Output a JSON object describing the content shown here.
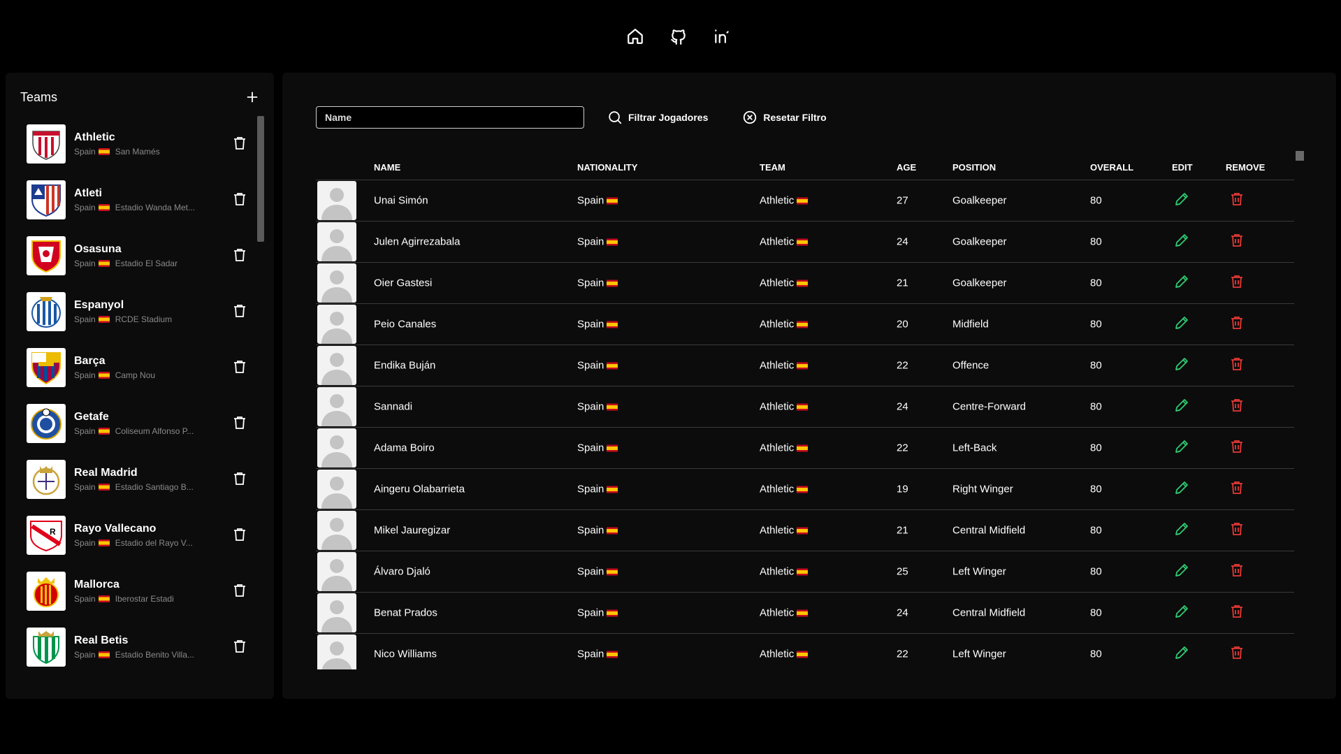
{
  "nav": {
    "icons": [
      "home-icon",
      "github-icon",
      "linkedin-icon"
    ]
  },
  "teams": {
    "title": "Teams",
    "items": [
      {
        "name": "Athletic",
        "country": "Spain",
        "stadium": "San Mamés"
      },
      {
        "name": "Atleti",
        "country": "Spain",
        "stadium": "Estadio Wanda Met..."
      },
      {
        "name": "Osasuna",
        "country": "Spain",
        "stadium": "Estadio El Sadar"
      },
      {
        "name": "Espanyol",
        "country": "Spain",
        "stadium": "RCDE Stadium"
      },
      {
        "name": "Barça",
        "country": "Spain",
        "stadium": "Camp Nou"
      },
      {
        "name": "Getafe",
        "country": "Spain",
        "stadium": "Coliseum Alfonso P..."
      },
      {
        "name": "Real Madrid",
        "country": "Spain",
        "stadium": "Estadio Santiago B..."
      },
      {
        "name": "Rayo Vallecano",
        "country": "Spain",
        "stadium": "Estadio del Rayo V..."
      },
      {
        "name": "Mallorca",
        "country": "Spain",
        "stadium": "Iberostar Estadi"
      },
      {
        "name": "Real Betis",
        "country": "Spain",
        "stadium": "Estadio Benito Villa..."
      }
    ]
  },
  "filter": {
    "name_placeholder": "Name",
    "name_value": "",
    "filter_label": "Filtrar Jogadores",
    "reset_label": "Resetar Filtro"
  },
  "table": {
    "headers": {
      "name": "NAME",
      "nationality": "NATIONALITY",
      "team": "TEAM",
      "age": "AGE",
      "position": "POSITION",
      "overall": "OVERALL",
      "edit": "EDIT",
      "remove": "REMOVE"
    },
    "rows": [
      {
        "name": "Unai Simón",
        "nationality": "Spain",
        "team": "Athletic",
        "age": "27",
        "position": "Goalkeeper",
        "overall": "80"
      },
      {
        "name": "Julen Agirrezabala",
        "nationality": "Spain",
        "team": "Athletic",
        "age": "24",
        "position": "Goalkeeper",
        "overall": "80"
      },
      {
        "name": "Oier Gastesi",
        "nationality": "Spain",
        "team": "Athletic",
        "age": "21",
        "position": "Goalkeeper",
        "overall": "80"
      },
      {
        "name": "Peio Canales",
        "nationality": "Spain",
        "team": "Athletic",
        "age": "20",
        "position": "Midfield",
        "overall": "80"
      },
      {
        "name": "Endika Buján",
        "nationality": "Spain",
        "team": "Athletic",
        "age": "22",
        "position": "Offence",
        "overall": "80"
      },
      {
        "name": "Sannadi",
        "nationality": "Spain",
        "team": "Athletic",
        "age": "24",
        "position": "Centre-Forward",
        "overall": "80"
      },
      {
        "name": "Adama Boiro",
        "nationality": "Spain",
        "team": "Athletic",
        "age": "22",
        "position": "Left-Back",
        "overall": "80"
      },
      {
        "name": "Aingeru Olabarrieta",
        "nationality": "Spain",
        "team": "Athletic",
        "age": "19",
        "position": "Right Winger",
        "overall": "80"
      },
      {
        "name": "Mikel Jauregizar",
        "nationality": "Spain",
        "team": "Athletic",
        "age": "21",
        "position": "Central Midfield",
        "overall": "80"
      },
      {
        "name": "Álvaro Djaló",
        "nationality": "Spain",
        "team": "Athletic",
        "age": "25",
        "position": "Left Winger",
        "overall": "80"
      },
      {
        "name": "Benat Prados",
        "nationality": "Spain",
        "team": "Athletic",
        "age": "24",
        "position": "Central Midfield",
        "overall": "80"
      },
      {
        "name": "Nico Williams",
        "nationality": "Spain",
        "team": "Athletic",
        "age": "22",
        "position": "Left Winger",
        "overall": "80"
      }
    ]
  },
  "colors": {
    "background": "#000000",
    "panel": "#0c0c0c",
    "edit": "#2ecc71",
    "remove": "#e53935",
    "muted": "#8a8a8a"
  }
}
